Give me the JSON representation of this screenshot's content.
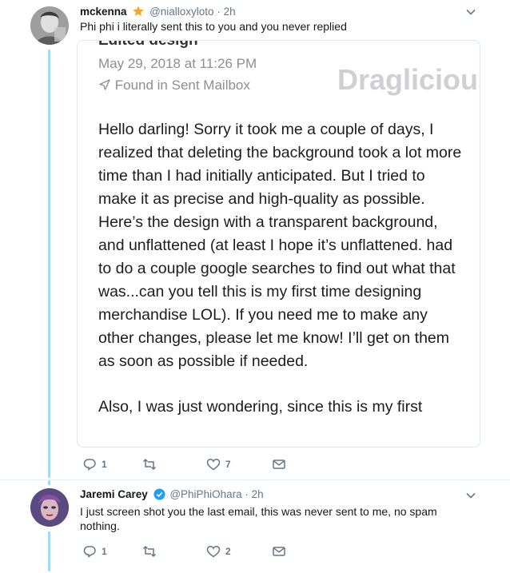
{
  "tweets": [
    {
      "name": "mckenna",
      "handle": "@nialloxyloto",
      "separator": "·",
      "time": "2h",
      "text": "Phi phi i literally sent this to you and you never replied",
      "attachment": {
        "subject": "Edited design",
        "date": "May 29, 2018 at 11:26 PM",
        "mailbox": "Found in Sent Mailbox",
        "watermark": "Draglicious",
        "paragraphs": [
          "Hello darling! Sorry it took me a couple of days, I realized that deleting the background took a lot more time than I had initially anticipated.  But I tried to make it as precise and high-quality as possible.  Here’s the design with a transparent background, and unflattened (at least I hope it’s unflattened. had to do a couple google searches to find out what that was...can you tell this is my first time designing merchandise LOL). If you need me to make any other changes, please let me know! I’ll get on them as soon as possible if needed.",
          "Also, I was just wondering, since this is my first"
        ]
      },
      "actions": {
        "replies": "1",
        "retweets": "",
        "likes": "7"
      }
    },
    {
      "name": "Jaremi Carey",
      "handle": "@PhiPhiOhara",
      "separator": "·",
      "time": "2h",
      "text": "I just screen shot you the last email, this was never sent to me, no spam nothing.",
      "actions": {
        "replies": "1",
        "retweets": "",
        "likes": "2"
      }
    }
  ],
  "colors": {
    "thread_line": "#a4d9f5",
    "verified": "#1da1f2",
    "star": "#f5a623",
    "icon_gray": "#657786"
  },
  "icons": [
    "star-badge-icon",
    "verified-badge-icon",
    "chevron-down-icon",
    "reply-icon",
    "retweet-icon",
    "like-icon",
    "message-icon",
    "send-arrow-icon"
  ]
}
